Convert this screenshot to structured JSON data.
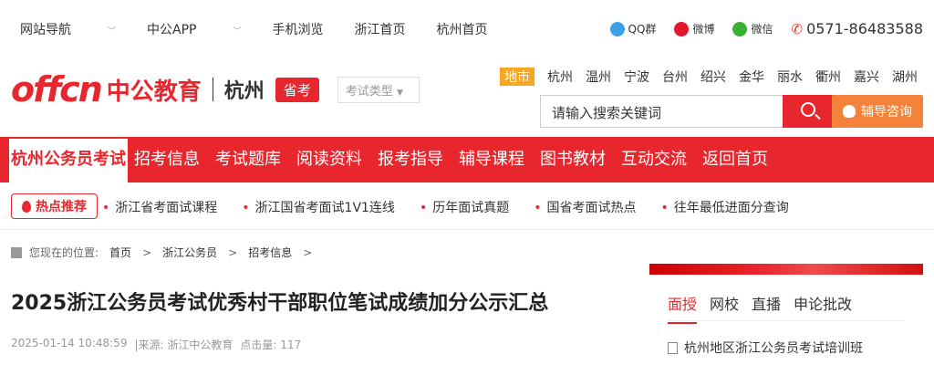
{
  "topbar": {
    "nav_label": "网站导航",
    "app_label": "中公APP",
    "mobile_label": "手机浏览",
    "zj_home": "浙江首页",
    "hz_home": "杭州首页",
    "qq": "QQ群",
    "weibo": "微博",
    "wechat": "微信",
    "phone": "0571-86483588"
  },
  "logo": {
    "en": "offcn",
    "cn": "中公教育",
    "city": "杭州",
    "tag": "省考",
    "select": "考试类型"
  },
  "cities": [
    "地市",
    "杭州",
    "温州",
    "宁波",
    "台州",
    "绍兴",
    "金华",
    "丽水",
    "衢州",
    "嘉兴",
    "湖州"
  ],
  "search": {
    "placeholder": "请输入搜索关键词"
  },
  "consult": "辅导咨询",
  "nav": [
    "杭州公务员考试",
    "招考信息",
    "考试题库",
    "阅读资料",
    "报考指导",
    "辅导课程",
    "图书教材",
    "互动交流",
    "返回首页"
  ],
  "hot": {
    "badge": "热点推荐",
    "links": [
      "浙江省考面试课程",
      "浙江国省考面试1V1连线",
      "历年面试真题",
      "国省考面试热点",
      "往年最低进面分查询"
    ]
  },
  "crumb": {
    "prefix": "您现在的位置:",
    "items": [
      "首页",
      "浙江公务员",
      "招考信息"
    ]
  },
  "article": {
    "title": "2025浙江公务员考试优秀村干部职位笔试成绩加分公示汇总",
    "date": "2025-01-14 10:48:59",
    "source": "|来源: 浙江中公教育",
    "clicks": "点击量: 117"
  },
  "side": {
    "tabs": [
      "面授",
      "网校",
      "直播",
      "申论批改"
    ],
    "first_row": "杭州地区浙江公务员考试培训班"
  },
  "colors": {
    "brand_red": "#e8262d",
    "orange": "#f5823a",
    "city_highlight": "#f5a623"
  }
}
